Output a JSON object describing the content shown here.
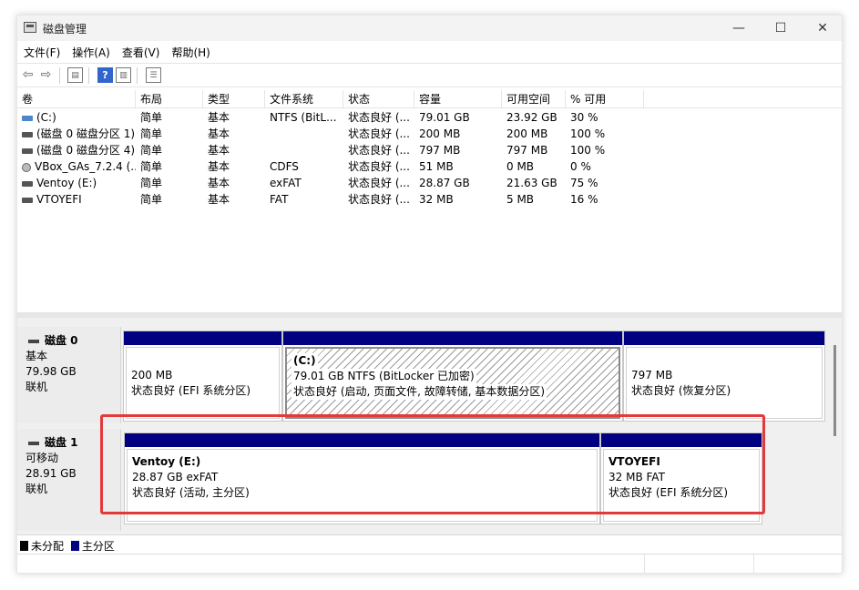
{
  "window": {
    "title": "磁盘管理",
    "controls": {
      "minimize": "—",
      "maximize": "☐",
      "close": "✕"
    }
  },
  "menu": [
    "文件(F)",
    "操作(A)",
    "查看(V)",
    "帮助(H)"
  ],
  "toolbar": {
    "icons": [
      "back-arrow-icon",
      "forward-arrow-icon",
      "list-view-icon",
      "help-icon",
      "disk-list-icon",
      "properties-icon"
    ]
  },
  "table": {
    "columns": [
      "卷",
      "布局",
      "类型",
      "文件系统",
      "状态",
      "容量",
      "可用空间",
      "% 可用"
    ],
    "rows": [
      {
        "volume": "(C:)",
        "layout": "简单",
        "type": "基本",
        "fs": "NTFS (BitL...",
        "status": "状态良好 (...",
        "capacity": "79.01 GB",
        "free": "23.92 GB",
        "pct": "30 %",
        "icon": "c"
      },
      {
        "volume": "(磁盘 0 磁盘分区 1)",
        "layout": "简单",
        "type": "基本",
        "fs": "",
        "status": "状态良好 (...",
        "capacity": "200 MB",
        "free": "200 MB",
        "pct": "100 %",
        "icon": "d"
      },
      {
        "volume": "(磁盘 0 磁盘分区 4)",
        "layout": "简单",
        "type": "基本",
        "fs": "",
        "status": "状态良好 (...",
        "capacity": "797 MB",
        "free": "797 MB",
        "pct": "100 %",
        "icon": "d"
      },
      {
        "volume": "VBox_GAs_7.2.4 (...",
        "layout": "简单",
        "type": "基本",
        "fs": "CDFS",
        "status": "状态良好 (...",
        "capacity": "51 MB",
        "free": "0 MB",
        "pct": "0 %",
        "icon": "cd"
      },
      {
        "volume": "Ventoy (E:)",
        "layout": "简单",
        "type": "基本",
        "fs": "exFAT",
        "status": "状态良好 (...",
        "capacity": "28.87 GB",
        "free": "21.63 GB",
        "pct": "75 %",
        "icon": "d"
      },
      {
        "volume": "VTOYEFI",
        "layout": "简单",
        "type": "基本",
        "fs": "FAT",
        "status": "状态良好 (...",
        "capacity": "32 MB",
        "free": "5 MB",
        "pct": "16 %",
        "icon": "d"
      }
    ]
  },
  "disks": [
    {
      "name": "磁盘 0",
      "kind": "基本",
      "size": "79.98 GB",
      "state": "联机",
      "parts": [
        {
          "title": "",
          "size": "200 MB",
          "status": "状态良好 (EFI 系统分区)"
        },
        {
          "title": "(C:)",
          "size": "79.01 GB NTFS (BitLocker 已加密)",
          "status": "状态良好 (启动, 页面文件, 故障转储, 基本数据分区)"
        },
        {
          "title": "",
          "size": "797 MB",
          "status": "状态良好 (恢复分区)"
        }
      ]
    },
    {
      "name": "磁盘 1",
      "kind": "可移动",
      "size": "28.91 GB",
      "state": "联机",
      "parts": [
        {
          "title": "Ventoy  (E:)",
          "size": "28.87 GB exFAT",
          "status": "状态良好 (活动, 主分区)"
        },
        {
          "title": "VTOYEFI",
          "size": "32 MB FAT",
          "status": "状态良好 (EFI 系统分区)"
        }
      ]
    }
  ],
  "legend": [
    {
      "label": "未分配",
      "color": "#000000"
    },
    {
      "label": "主分区",
      "color": "#000080"
    }
  ],
  "colors": {
    "primary_partition": "#000080",
    "highlight": "#e23a3a"
  }
}
